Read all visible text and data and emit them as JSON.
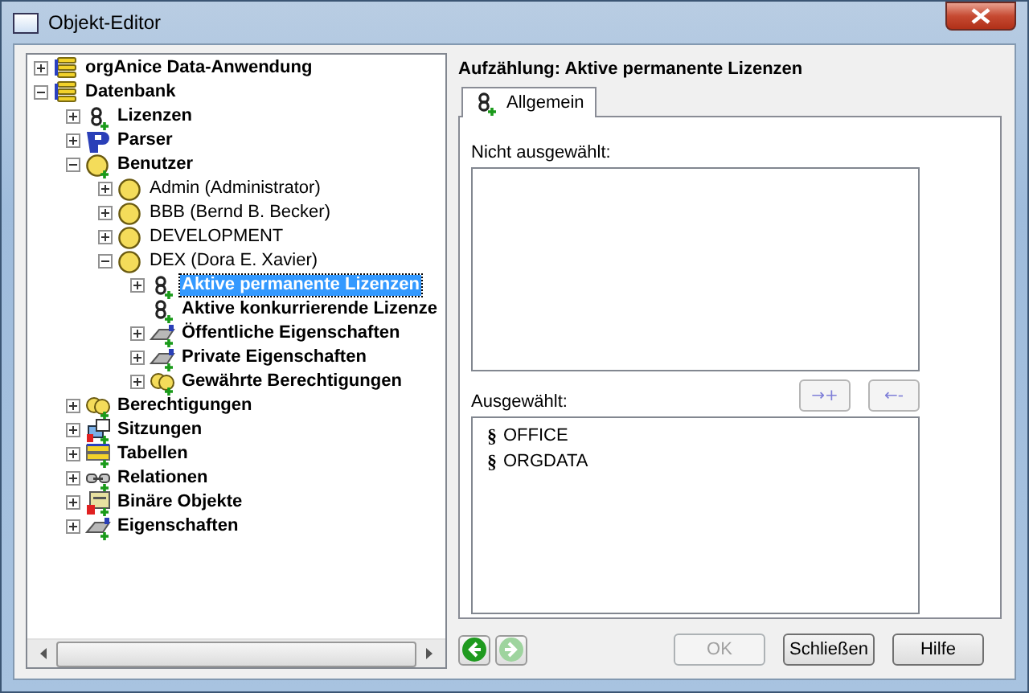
{
  "window": {
    "title": "Objekt-Editor"
  },
  "tree": {
    "items": [
      {
        "label": "orgAnice Data-Anwendung",
        "kind": "database",
        "bold": true,
        "plus_badge": false,
        "expandable": true,
        "expanded": false,
        "selected": false
      },
      {
        "label": "Datenbank",
        "kind": "database",
        "bold": true,
        "plus_badge": false,
        "expandable": true,
        "expanded": true,
        "selected": false,
        "children": [
          {
            "label": "Lizenzen",
            "kind": "section",
            "bold": true,
            "plus_badge": true,
            "expandable": true,
            "expanded": false,
            "selected": false
          },
          {
            "label": "Parser",
            "kind": "parser",
            "bold": true,
            "plus_badge": false,
            "expandable": true,
            "expanded": false,
            "selected": false
          },
          {
            "label": "Benutzer",
            "kind": "user",
            "bold": true,
            "plus_badge": true,
            "expandable": true,
            "expanded": true,
            "selected": false,
            "children": [
              {
                "label": "Admin (Administrator)",
                "kind": "user",
                "bold": false,
                "plus_badge": false,
                "expandable": true,
                "expanded": false,
                "selected": false
              },
              {
                "label": "BBB (Bernd B. Becker)",
                "kind": "user",
                "bold": false,
                "plus_badge": false,
                "expandable": true,
                "expanded": false,
                "selected": false
              },
              {
                "label": "DEVELOPMENT",
                "kind": "user",
                "bold": false,
                "plus_badge": false,
                "expandable": true,
                "expanded": false,
                "selected": false
              },
              {
                "label": "DEX (Dora E. Xavier)",
                "kind": "user",
                "bold": false,
                "plus_badge": false,
                "expandable": true,
                "expanded": true,
                "selected": false,
                "children": [
                  {
                    "label": "Aktive permanente Lizenzen",
                    "kind": "section",
                    "bold": true,
                    "plus_badge": true,
                    "expandable": true,
                    "expanded": false,
                    "selected": true
                  },
                  {
                    "label": "Aktive konkurrierende Lizenze",
                    "kind": "section",
                    "bold": true,
                    "plus_badge": true,
                    "expandable": false,
                    "selected": false
                  },
                  {
                    "label": "Öffentliche Eigenschaften",
                    "kind": "properties",
                    "bold": true,
                    "plus_badge": true,
                    "expandable": true,
                    "expanded": false,
                    "selected": false
                  },
                  {
                    "label": "Private Eigenschaften",
                    "kind": "properties",
                    "bold": true,
                    "plus_badge": true,
                    "expandable": true,
                    "expanded": false,
                    "selected": false
                  },
                  {
                    "label": "Gewährte Berechtigungen",
                    "kind": "people",
                    "bold": true,
                    "plus_badge": true,
                    "expandable": true,
                    "expanded": false,
                    "selected": false
                  }
                ]
              }
            ]
          },
          {
            "label": "Berechtigungen",
            "kind": "people",
            "bold": true,
            "plus_badge": true,
            "expandable": true,
            "expanded": false,
            "selected": false
          },
          {
            "label": "Sitzungen",
            "kind": "sessions",
            "bold": true,
            "plus_badge": true,
            "expandable": true,
            "expanded": false,
            "selected": false
          },
          {
            "label": "Tabellen",
            "kind": "tables",
            "bold": true,
            "plus_badge": true,
            "expandable": true,
            "expanded": false,
            "selected": false
          },
          {
            "label": "Relationen",
            "kind": "relations",
            "bold": true,
            "plus_badge": true,
            "expandable": true,
            "expanded": false,
            "selected": false
          },
          {
            "label": "Binäre Objekte",
            "kind": "binary",
            "bold": true,
            "plus_badge": true,
            "expandable": true,
            "expanded": false,
            "selected": false
          },
          {
            "label": "Eigenschaften",
            "kind": "properties",
            "bold": true,
            "plus_badge": true,
            "expandable": true,
            "expanded": false,
            "selected": false
          }
        ]
      }
    ]
  },
  "detail": {
    "heading": "Aufzählung: Aktive permanente Lizenzen",
    "tabs": [
      {
        "label": "Allgemein",
        "kind": "section",
        "selected": true
      }
    ],
    "available": {
      "label": "Nicht ausgewählt:"
    },
    "move_buttons": [
      {
        "label": "→+",
        "disabled": true
      },
      {
        "label": "←-",
        "disabled": true
      }
    ],
    "chosen": {
      "label": "Ausgewählt:",
      "items": [
        {
          "symbol": "§",
          "label": "OFFICE"
        },
        {
          "symbol": "§",
          "label": "ORGDATA"
        }
      ]
    }
  },
  "footer": {
    "nav": [
      {
        "kind": "back",
        "disabled": false
      },
      {
        "kind": "forward",
        "disabled": true
      }
    ],
    "buttons": [
      {
        "label": "OK",
        "disabled": true
      },
      {
        "label": "Schließen",
        "disabled": false
      },
      {
        "label": "Hilfe",
        "disabled": false
      }
    ]
  }
}
